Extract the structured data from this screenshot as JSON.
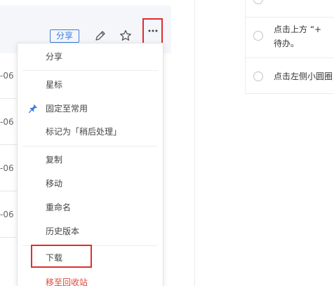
{
  "header": {
    "share_badge": "分享",
    "icons": [
      "edit-pencil-icon",
      "star-outline-icon",
      "more-dots-icon"
    ]
  },
  "list": {
    "dates": [
      "-06",
      "-06",
      "-06",
      "-06"
    ]
  },
  "menu": {
    "items": [
      {
        "label": "分享",
        "icon": null
      },
      {
        "label": "星标",
        "icon": null
      },
      {
        "label": "固定至常用",
        "icon": "pin-icon"
      },
      {
        "label": "标记为「稍后处理」",
        "icon": null
      },
      {
        "label": "复制",
        "icon": null
      },
      {
        "label": "移动",
        "icon": null
      },
      {
        "label": "重命名",
        "icon": null
      },
      {
        "label": "历史版本",
        "icon": null
      },
      {
        "label": "下载",
        "icon": null
      },
      {
        "label": "移至回收站",
        "icon": null
      }
    ]
  },
  "todo": {
    "items": [
      {
        "line1": "点击上方 “+",
        "line2": "待办。"
      },
      {
        "line1": "点击左侧小圆圈",
        "line2": ""
      }
    ]
  },
  "colors": {
    "accent": "#3b7ddd",
    "highlight": "#e02d2d",
    "danger": "#e0463b"
  }
}
